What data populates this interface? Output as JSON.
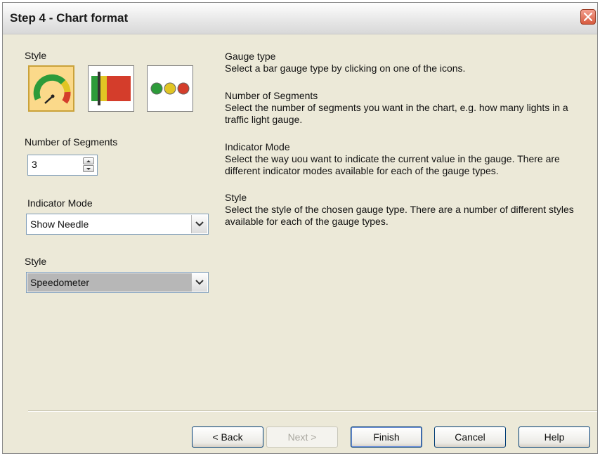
{
  "window": {
    "title": "Step 4 - Chart format",
    "close_icon": "close-icon"
  },
  "left": {
    "style_label": "Style",
    "gauge_icons": [
      {
        "name": "speedometer-gauge-icon",
        "selected": true
      },
      {
        "name": "bar-gauge-icon",
        "selected": false
      },
      {
        "name": "traffic-light-gauge-icon",
        "selected": false
      }
    ],
    "segments_label": "Number of Segments",
    "segments_value": "3",
    "indicator_label": "Indicator Mode",
    "indicator_value": "Show Needle",
    "style2_label": "Style",
    "style_value": "Speedometer"
  },
  "help": [
    {
      "heading": "Gauge type",
      "text": "Select a bar gauge type by clicking on one of the icons."
    },
    {
      "heading": "Number of Segments",
      "text": "Select the number of segments you want in the chart, e.g. how many lights in a traffic light gauge."
    },
    {
      "heading": "Indicator Mode",
      "text": "Select the way uou want to indicate the current value in the gauge. There are different indicator modes available for each of the gauge types."
    },
    {
      "heading": "Style",
      "text": "Select the style of the chosen gauge type. There are a number of different styles available for each of the gauge types."
    }
  ],
  "buttons": {
    "back": "< Back",
    "next": "Next >",
    "finish": "Finish",
    "cancel": "Cancel",
    "help": "Help"
  },
  "colors": {
    "selected_icon_bg": "#fbd98a",
    "window_bg": "#ece9d8"
  }
}
